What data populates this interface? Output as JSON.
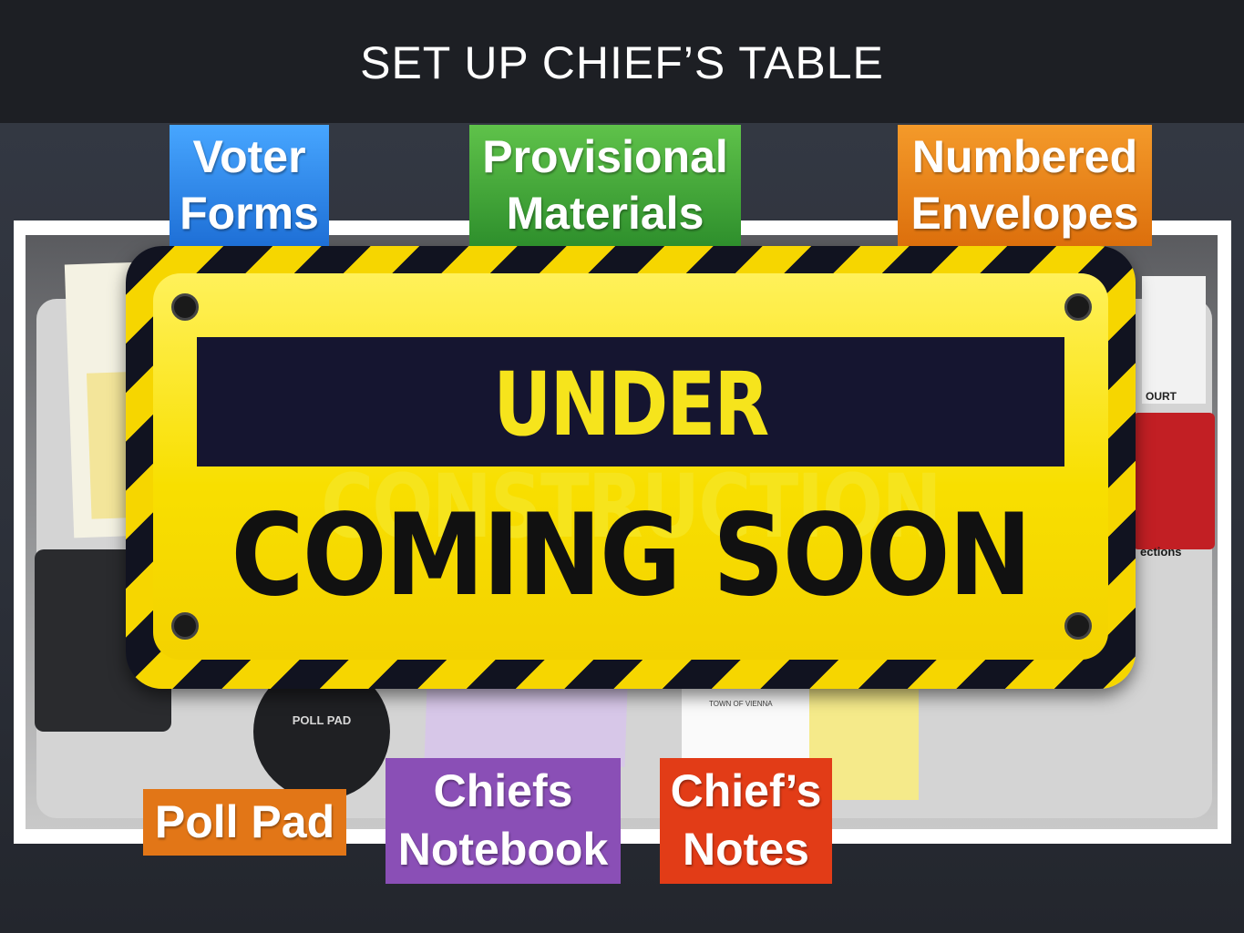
{
  "slide": {
    "title": "SET UP CHIEF’S TABLE"
  },
  "sign": {
    "line1": "UNDER CONSTRUCTION",
    "line2": "COMING SOON"
  },
  "labels": {
    "voter_forms": [
      "Voter",
      "Forms"
    ],
    "provisional_materials": [
      "Provisional",
      "Materials"
    ],
    "numbered_envelopes": [
      "Numbered",
      "Envelopes"
    ],
    "poll_pad": "Poll Pad",
    "chiefs_notebook": [
      "Chiefs",
      "Notebook"
    ],
    "chiefs_notes": [
      "Chief’s",
      "Notes"
    ]
  },
  "photo_text": {
    "poll_disc": "POLL PAD",
    "notes_card": "TOWN OF VIENNA",
    "bag_text": "ections",
    "paper_right": "OURT"
  },
  "colors": {
    "title_bar": "#1d1f24",
    "voter_forms": "#2b86e8",
    "provisional_materials": "#3ea235",
    "numbered_envelopes": "#ea8418",
    "poll_pad": "#e27617",
    "chiefs_notebook": "#8a4fb6",
    "chiefs_notes": "#e23c17",
    "sign_yellow": "#f8df00",
    "sign_band": "#151530"
  }
}
